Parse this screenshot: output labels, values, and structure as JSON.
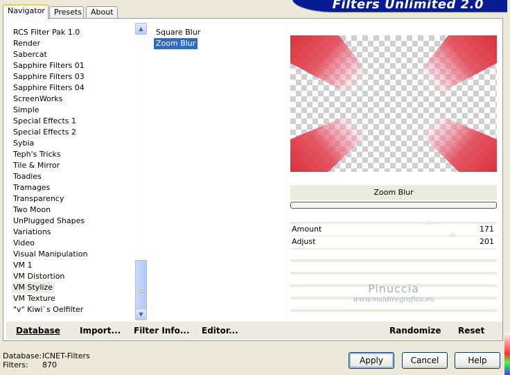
{
  "tabs": [
    "Navigator",
    "Presets",
    "About"
  ],
  "title": "Filters Unlimited 2.0",
  "categories": [
    "RCS Filter Pak 1.0",
    "Render",
    "Sabercat",
    "Sapphire Filters 01",
    "Sapphire Filters 03",
    "Sapphire Filters 04",
    "ScreenWorks",
    "Simple",
    "Special Effects 1",
    "Special Effects 2",
    "Sybia",
    "Teph's Tricks",
    "Tile & Mirror",
    "Toadies",
    "Tramages",
    "Transparency",
    "Two Moon",
    "UnPlugged Shapes",
    "Variations",
    "Video",
    "Visual Manipulation",
    "VM 1",
    "VM Distortion",
    "VM Stylize",
    "VM Texture",
    "\"v\" Kiwi`s Oelfilter"
  ],
  "selected_category": "VM Stylize",
  "filters": [
    "Square Blur",
    "Zoom Blur"
  ],
  "selected_filter": "Zoom Blur",
  "filter_name": "Zoom Blur",
  "params": [
    {
      "label": "Amount",
      "value": "171"
    },
    {
      "label": "Adjust",
      "value": "201"
    }
  ],
  "watermark": {
    "name": "Pinuccia",
    "url": "www.maidiregrafica.eu"
  },
  "bottom_buttons": {
    "database": "Database",
    "import": "Import...",
    "filter_info": "Filter Info...",
    "editor": "Editor...",
    "randomize": "Randomize",
    "reset": "Reset"
  },
  "status": {
    "database_label": "Database:",
    "database_value": "ICNET-Filters",
    "filters_label": "Filters:",
    "filters_value": "870"
  },
  "dialog_buttons": {
    "apply": "Apply",
    "cancel": "Cancel",
    "help": "Help"
  },
  "colors": {
    "selection": "#316ac5",
    "banner": "#071b93",
    "preview_ray": "#e0343a"
  }
}
